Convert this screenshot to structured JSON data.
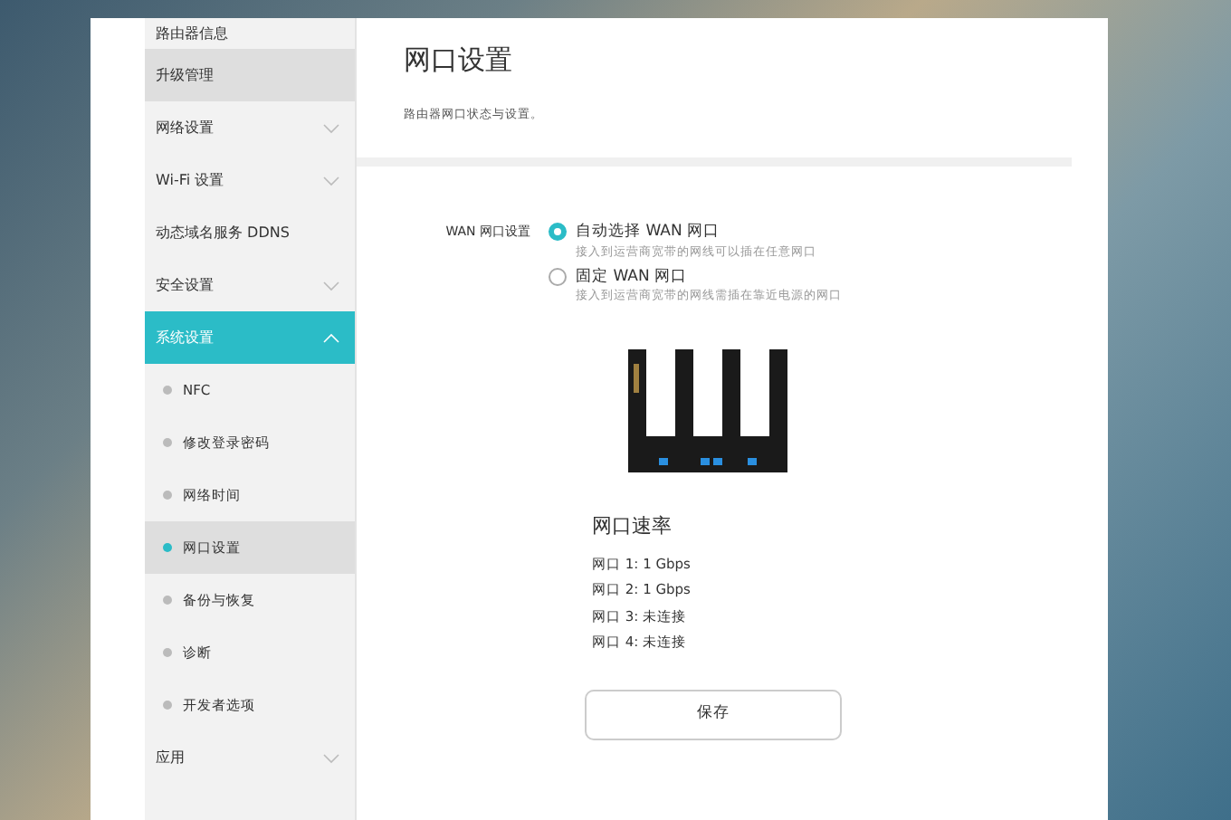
{
  "sidebar": {
    "items": [
      {
        "label": "路由器信息",
        "kind": "link",
        "selected": false,
        "hovered": false
      },
      {
        "label": "升级管理",
        "kind": "link",
        "selected": false,
        "hovered": true
      },
      {
        "label": "网络设置",
        "kind": "group",
        "selected": false,
        "hovered": false,
        "expanded": false
      },
      {
        "label": "Wi-Fi 设置",
        "kind": "group",
        "selected": false,
        "hovered": false,
        "expanded": false
      },
      {
        "label": "动态域名服务 DDNS",
        "kind": "link",
        "selected": false,
        "hovered": false
      },
      {
        "label": "安全设置",
        "kind": "group",
        "selected": false,
        "hovered": false,
        "expanded": false
      },
      {
        "label": "系统设置",
        "kind": "group",
        "selected": true,
        "hovered": false,
        "expanded": true,
        "children": [
          {
            "label": "NFC",
            "selected": false
          },
          {
            "label": "修改登录密码",
            "selected": false
          },
          {
            "label": "网络时间",
            "selected": false
          },
          {
            "label": "网口设置",
            "selected": true
          },
          {
            "label": "备份与恢复",
            "selected": false
          },
          {
            "label": "诊断",
            "selected": false
          },
          {
            "label": "开发者选项",
            "selected": false
          }
        ]
      },
      {
        "label": "应用",
        "kind": "group",
        "selected": false,
        "hovered": false,
        "expanded": false
      }
    ]
  },
  "page": {
    "title": "网口设置",
    "subtitle": "路由器网口状态与设置。"
  },
  "wan": {
    "label": "WAN 网口设置",
    "options": [
      {
        "label": "自动选择 WAN 网口",
        "hint": "接入到运营商宽带的网线可以插在任意网口",
        "selected": true
      },
      {
        "label": "固定 WAN 网口",
        "hint": "接入到运营商宽带的网线需插在靠近电源的网口",
        "selected": false
      }
    ]
  },
  "port_speed": {
    "title": "网口速率",
    "ports": [
      {
        "label": "网口 1:",
        "value": "1 Gbps"
      },
      {
        "label": "网口 2:",
        "value": "1 Gbps"
      },
      {
        "label": "网口 3:",
        "value": "未连接"
      },
      {
        "label": "网口 4:",
        "value": "未连接"
      }
    ]
  },
  "save_button": "保存"
}
